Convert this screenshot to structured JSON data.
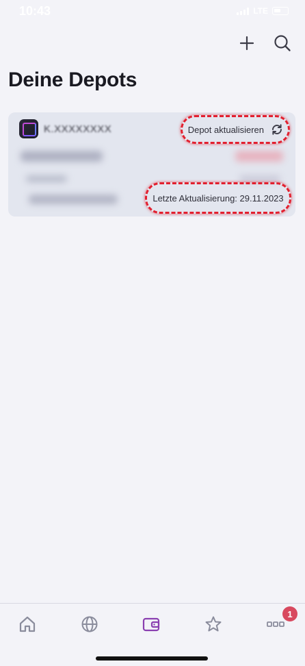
{
  "status_bar": {
    "time": "10:43",
    "network": "LTE"
  },
  "header": {
    "title": "Deine Depots"
  },
  "depot_card": {
    "account": "K.XXXXXXXX",
    "refresh_label": "Depot aktualisieren",
    "last_update_label": "Letzte Aktualisierung: 29.11.2023"
  },
  "tab_bar": {
    "items": [
      {
        "icon": "home-icon"
      },
      {
        "icon": "globe-icon"
      },
      {
        "icon": "wallet-icon"
      },
      {
        "icon": "star-icon"
      },
      {
        "icon": "more-icon"
      }
    ],
    "active_index": 2,
    "more_badge": "1"
  },
  "colors": {
    "background": "#f3f3f8",
    "card": "#e3e6ef",
    "accent_active": "#8a3fb0",
    "inactive_icon": "#8a8c9c",
    "highlight": "#e2202f",
    "badge": "#d8495f"
  }
}
